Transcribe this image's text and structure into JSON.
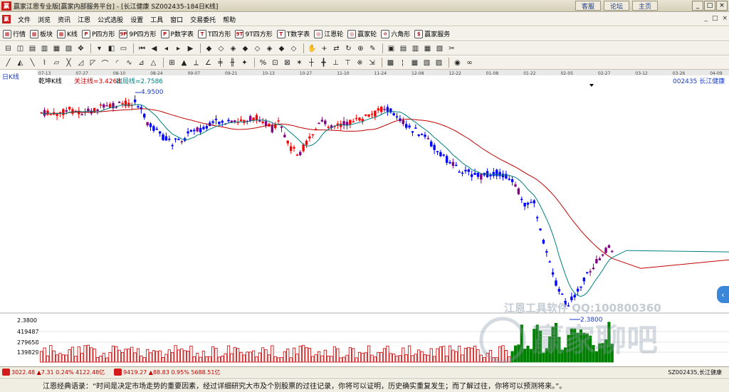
{
  "window": {
    "title": "赢家江恩专业版[赢家内部服务平台] - [长江健康  SZ002435-184日K线]",
    "links": [
      "客服",
      "论坛",
      "主页"
    ],
    "controls": [
      "_",
      "□",
      "×"
    ]
  },
  "menu": {
    "items": [
      "文件",
      "浏览",
      "资讯",
      "江恩",
      "公式选股",
      "设置",
      "工具",
      "窗口",
      "交易委托",
      "帮助"
    ],
    "right_controls": [
      "_",
      "□",
      "×"
    ]
  },
  "toolbar1": {
    "items": [
      {
        "label": "行情",
        "icon": "quote-icon"
      },
      {
        "label": "板块",
        "icon": "sector-icon"
      },
      {
        "label": "K线",
        "icon": "kline-icon"
      },
      {
        "label": "P四方形",
        "icon": "p-square-icon",
        "glyph": "P"
      },
      {
        "label": "9P四方形",
        "icon": "9p-square-icon",
        "glyph": "9P"
      },
      {
        "label": "P数字表",
        "icon": "p-table-icon",
        "glyph": "P"
      },
      {
        "label": "T四方形",
        "icon": "t-square-icon",
        "glyph": "T"
      },
      {
        "label": "9T四方形",
        "icon": "9t-square-icon",
        "glyph": "9T"
      },
      {
        "label": "T数字表",
        "icon": "t-table-icon",
        "glyph": "T"
      },
      {
        "label": "江恩轮",
        "icon": "gann-wheel-icon",
        "glyph": "◎"
      },
      {
        "label": "赢家轮",
        "icon": "winner-wheel-icon",
        "glyph": "◎"
      },
      {
        "label": "六角形",
        "icon": "hexagon-icon",
        "glyph": "✡"
      },
      {
        "label": "赢家服务",
        "icon": "service-icon",
        "glyph": "$"
      }
    ]
  },
  "toolbar2_glyphs": [
    "⊟",
    "◫",
    "▤",
    "▥",
    "▦",
    "▧",
    "✥",
    "▾",
    "◧",
    "▭",
    "⏮",
    "◀",
    "◂",
    "▸",
    "▶",
    "◆",
    "◇",
    "◈",
    "◆",
    "◇",
    "◈",
    "◆",
    "◇",
    "✋",
    "+",
    "⇄",
    "↻",
    "⊕",
    "✎",
    "▣",
    "▤",
    "▥",
    "▦",
    "▧",
    "✂"
  ],
  "toolbar3_glyphs": [
    "╱",
    "◭",
    "╲",
    "⌇",
    "▱",
    "╳",
    "◿",
    "◸",
    "⌒",
    "◜",
    "∿",
    "⊿",
    "△",
    "⊞",
    "▲",
    "⟂",
    "∠",
    "╪",
    "╫",
    "✦",
    "%",
    "⊡",
    "⊠",
    "✶",
    "┼",
    "╋",
    "⊥",
    "⊤",
    "※",
    "⇲",
    "▩",
    "¦",
    "▦",
    "▧",
    "▨",
    "◉",
    "∞"
  ],
  "chart": {
    "period_label": "日K线",
    "indicator_name": "乾坤K线",
    "attention_line": "关注线=3.4268",
    "exit_line": "出局线=2.7586",
    "stock_label": "002435  长江健康",
    "high_label": "4.9500",
    "low_label": "2.3800",
    "price_axis_label": "2.3800",
    "volume_ticks": [
      "419487",
      "279658",
      "139829"
    ],
    "date_ticks": [
      "07-13",
      "07-27",
      "08-10",
      "08-24",
      "09-07",
      "09-21",
      "10-13",
      "10-27",
      "11-10",
      "11-24",
      "12-08",
      "12-22",
      "01-08",
      "01-22",
      "02-05",
      "02-27",
      "03-12",
      "03-26",
      "04-09"
    ],
    "colors": {
      "up": "#ff0000",
      "down": "#0000ff",
      "neutral": "#800080",
      "attention": "#c00000",
      "exit": "#008080",
      "volume_up": "#cc0000",
      "volume_down": "#008000"
    }
  },
  "watermark": {
    "contact": "江恩工具软件  QQ:100800360",
    "site_text": "赢家聊吧"
  },
  "bottom_bar": {
    "sh_index": "3022.48 ▲7.31 0.24% 4122.48亿",
    "sz_index": "9419.27 ▲88.83 0.95% 5688.51亿",
    "symbol": "SZ002435,长江健康"
  },
  "status": {
    "quote": "江恩经典语录：“时间是决定市场走势的重要因素，经过详细研究大市及个别股票的过往记录，你将可以证明，历史确实重复发生；而了解过往，你将可以预测将来。”。"
  }
}
